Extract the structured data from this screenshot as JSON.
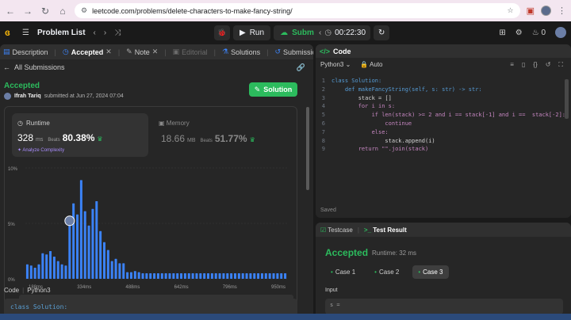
{
  "browser": {
    "url": "leetcode.com/problems/delete-characters-to-make-fancy-string/"
  },
  "topbar": {
    "problem_list": "Problem List",
    "run": "Run",
    "submit": "Submit",
    "timer": "00:22:30",
    "notifications": "0"
  },
  "left": {
    "tabs": [
      {
        "label": "Description"
      },
      {
        "label": "Accepted"
      },
      {
        "label": "Note"
      },
      {
        "label": "Editorial"
      },
      {
        "label": "Solutions"
      },
      {
        "label": "Submissions"
      }
    ],
    "all_submissions": "All Submissions",
    "status": "Accepted",
    "submitter_name": "Ifrah Tariq",
    "submitted_text": "submitted at Jun 27, 2024 07:04",
    "solution_button": "Solution",
    "runtime": {
      "title": "Runtime",
      "value": "328",
      "unit": "ms",
      "beats_label": "Beats",
      "beats_pct": "80.38%",
      "analyze": "Analyze Complexity"
    },
    "memory": {
      "title": "Memory",
      "value": "18.66",
      "unit": "MB",
      "beats_label": "Beats",
      "beats_pct": "51.77%"
    },
    "code_label": "Code",
    "code_lang": "Python3",
    "code_preview": "class Solution:"
  },
  "chart_data": {
    "type": "bar",
    "ytick_labels": [
      "10%",
      "5%",
      "0%"
    ],
    "ylim": [
      0,
      10
    ],
    "xtick_labels": [
      "188ms",
      "334ms",
      "488ms",
      "642ms",
      "796ms",
      "950ms"
    ],
    "values": [
      1.3,
      1.2,
      1.0,
      1.3,
      2.3,
      2.2,
      2.5,
      2.0,
      1.6,
      1.3,
      1.2,
      4.8,
      6.8,
      5.8,
      8.9,
      6.1,
      4.8,
      6.3,
      7.0,
      4.3,
      3.3,
      2.6,
      1.6,
      1.8,
      1.4,
      1.4,
      0.6,
      0.6,
      0.7,
      0.6,
      0.5,
      0.5,
      0.5,
      0.5,
      0.5,
      0.5,
      0.5,
      0.5,
      0.5,
      0.5,
      0.5,
      0.5,
      0.5,
      0.5,
      0.5,
      0.5,
      0.5,
      0.5,
      0.5,
      0.5,
      0.5,
      0.5,
      0.5,
      0.5,
      0.5,
      0.5,
      0.5,
      0.5,
      0.5,
      0.5,
      0.5,
      0.5,
      0.5,
      0.5,
      0.5,
      0.5,
      0.5,
      0.5
    ],
    "highlight_index": 11,
    "colors": {
      "bar": "#3b82f6",
      "grid": "#3a3a3a"
    }
  },
  "editor": {
    "panel_title": "Code",
    "language": "Python3",
    "mode": "Auto",
    "saved": "Saved",
    "lines": [
      "class Solution:",
      "    def makeFancyString(self, s: str) -> str:",
      "        stack = []",
      "        for i in s:",
      "            if len(stack) >= 2 and i == stack[-1] and i ==  stack[-2]:",
      "                continue",
      "            else:",
      "                stack.append(i)",
      "        return \"\".join(stack)"
    ]
  },
  "testresult": {
    "testcase_tab": "Testcase",
    "result_tab": "Test Result",
    "status": "Accepted",
    "runtime": "Runtime: 32 ms",
    "cases": [
      "Case 1",
      "Case 2",
      "Case 3"
    ],
    "selected_case": 2,
    "input_label": "Input",
    "input_value": "s ="
  }
}
